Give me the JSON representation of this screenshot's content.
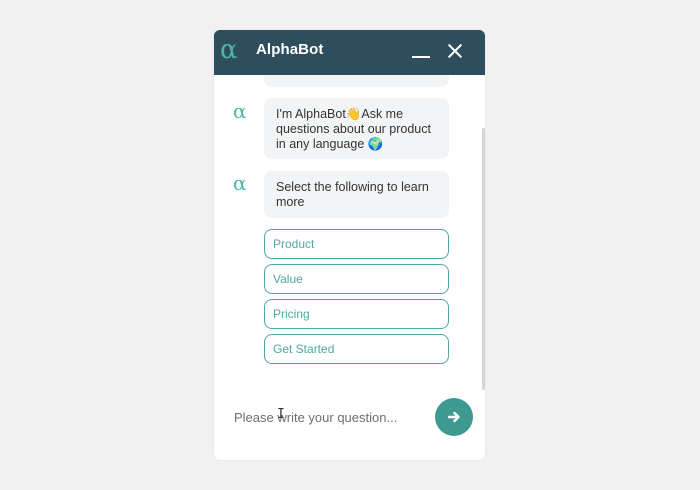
{
  "window": {
    "logo_glyph": "α",
    "title": "AlphaBot",
    "minimize_icon": "minimize-icon",
    "close_icon": "close-icon",
    "header_color": "#2e4e5e",
    "accent_color": "#4fb3a6"
  },
  "messages": [
    {
      "avatar": "α",
      "text": "I'm AlphaBot👋Ask me questions about our product in any language 🌍"
    },
    {
      "avatar": "α",
      "text": "Select the following to learn more"
    }
  ],
  "options": [
    "Product",
    "Value",
    "Pricing",
    "Get Started"
  ],
  "composer": {
    "placeholder": "Please write your question...",
    "send_icon": "arrow-right-icon"
  }
}
